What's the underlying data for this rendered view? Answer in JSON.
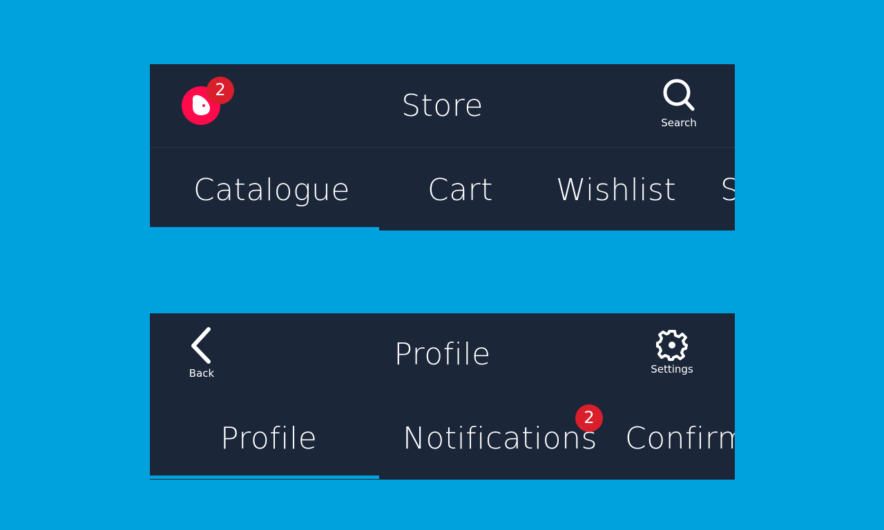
{
  "store_bar": {
    "title": "Store",
    "avatar_badge": "2",
    "search_label": "Search",
    "tabs": [
      {
        "label": "Catalogue",
        "active": true
      },
      {
        "label": "Cart",
        "active": false
      },
      {
        "label": "Wishlist",
        "active": false
      },
      {
        "label": "S",
        "active": false
      }
    ]
  },
  "profile_bar": {
    "title": "Profile",
    "back_label": "Back",
    "settings_label": "Settings",
    "notifications_badge": "2",
    "tabs": [
      {
        "label": "Profile",
        "active": true
      },
      {
        "label": "Notifications",
        "active": false
      },
      {
        "label": "Confirm",
        "active": false
      }
    ]
  },
  "colors": {
    "background": "#00a2de",
    "bar": "#1c2639",
    "accent": "#00a2de",
    "avatar": "#ff0a4a",
    "badge": "#d81f2b"
  },
  "icons": {
    "avatar": "character-avatar-icon",
    "search": "search-icon",
    "back": "chevron-left-icon",
    "settings": "gear-icon"
  }
}
